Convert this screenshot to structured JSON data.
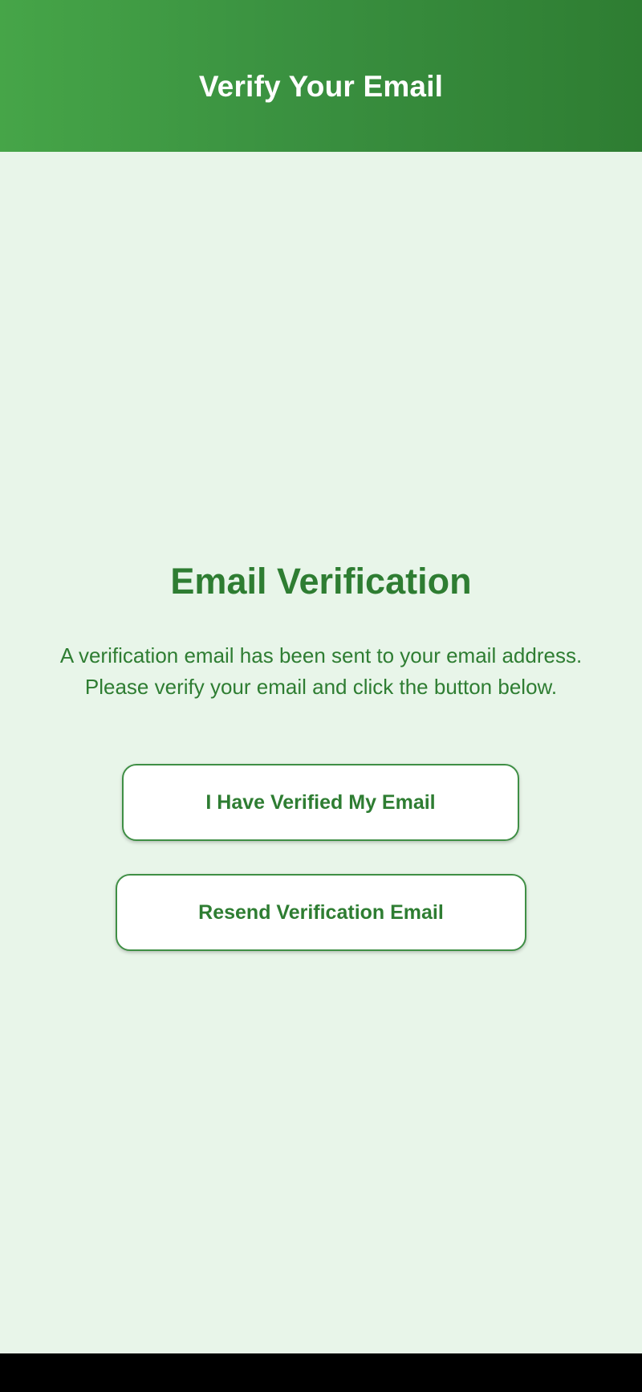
{
  "app_bar": {
    "title": "Verify Your Email"
  },
  "main": {
    "heading": "Email Verification",
    "message": "A verification email has been sent to your email address. Please verify your email and click the button below.",
    "verified_button_label": "I Have Verified My Email",
    "resend_button_label": "Resend Verification Email"
  },
  "colors": {
    "primary_green": "#2e7d32",
    "app_bar_gradient_start": "#46a548",
    "background": "#e8f5e9",
    "button_background": "#ffffff",
    "system_nav_bar": "#000000"
  }
}
